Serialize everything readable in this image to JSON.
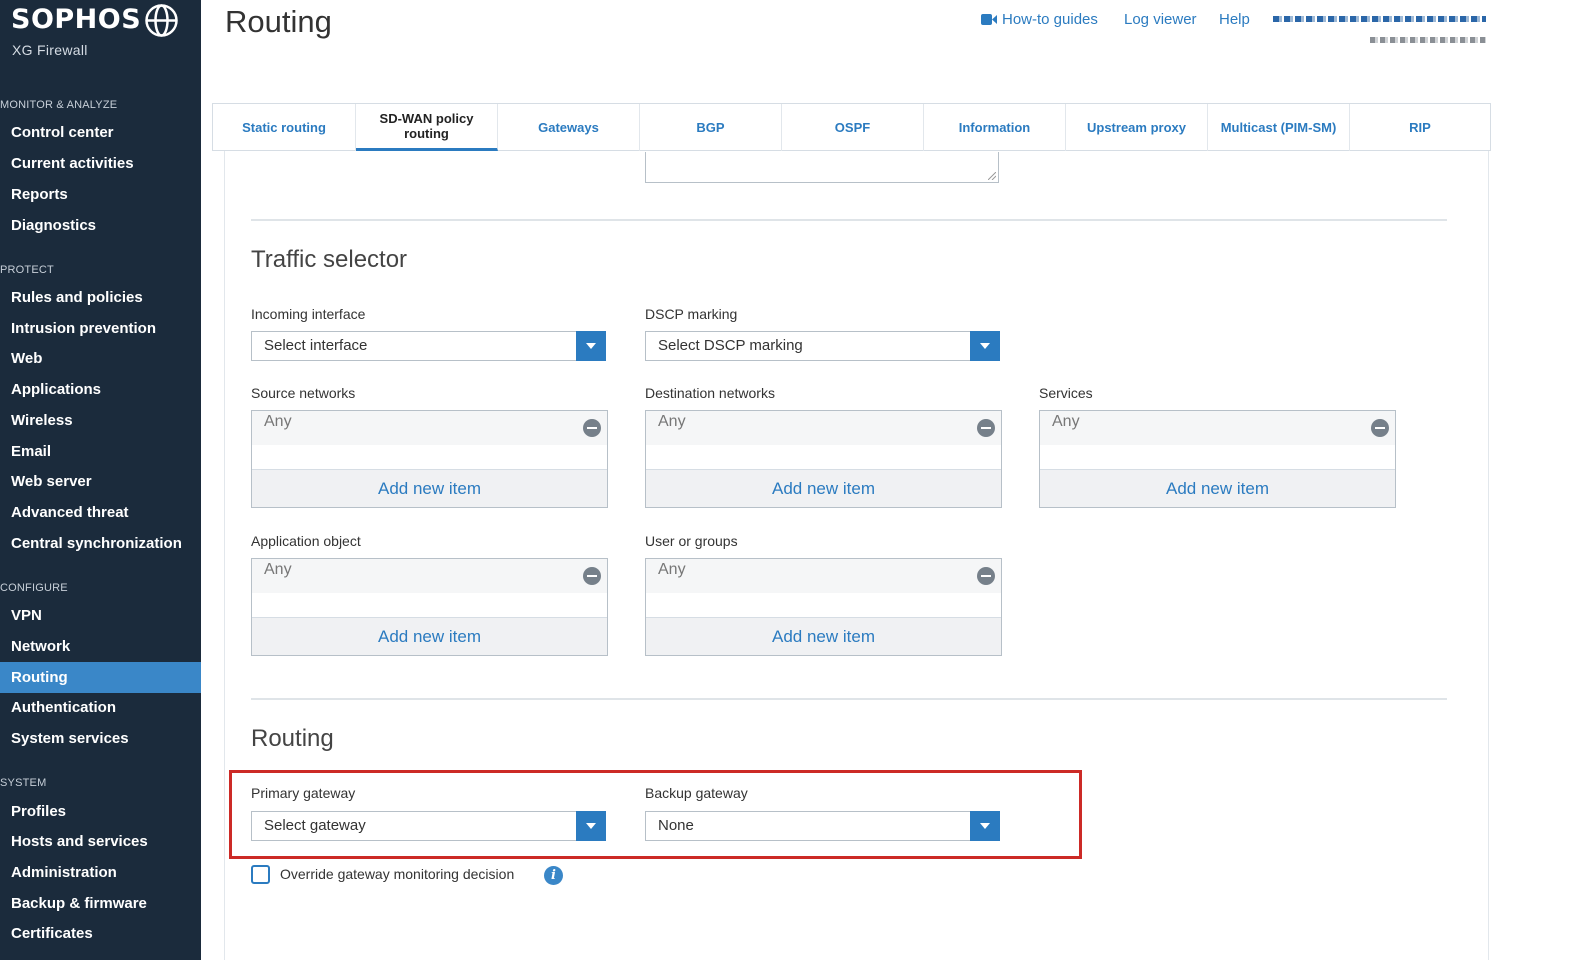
{
  "brand": {
    "name": "SOPHOS",
    "product": "XG Firewall"
  },
  "sidebar": {
    "sections": [
      {
        "title": "MONITOR & ANALYZE",
        "items": [
          "Control center",
          "Current activities",
          "Reports",
          "Diagnostics"
        ]
      },
      {
        "title": "PROTECT",
        "items": [
          "Rules and policies",
          "Intrusion prevention",
          "Web",
          "Applications",
          "Wireless",
          "Email",
          "Web server",
          "Advanced threat",
          "Central synchronization"
        ]
      },
      {
        "title": "CONFIGURE",
        "items": [
          "VPN",
          "Network",
          "Routing",
          "Authentication",
          "System services"
        ]
      },
      {
        "title": "SYSTEM",
        "items": [
          "Profiles",
          "Hosts and services",
          "Administration",
          "Backup & firmware",
          "Certificates"
        ]
      }
    ],
    "active_item": "Routing"
  },
  "header": {
    "title": "Routing",
    "links": {
      "howto": "How-to guides",
      "log": "Log viewer",
      "help": "Help"
    }
  },
  "tabs": [
    "Static routing",
    "SD-WAN policy routing",
    "Gateways",
    "BGP",
    "OSPF",
    "Information",
    "Upstream proxy",
    "Multicast (PIM-SM)",
    "RIP"
  ],
  "active_tab": "SD-WAN policy routing",
  "traffic_selector": {
    "title": "Traffic selector",
    "incoming_interface": {
      "label": "Incoming interface",
      "value": "Select interface"
    },
    "dscp_marking": {
      "label": "DSCP marking",
      "value": "Select DSCP marking"
    },
    "source_networks": {
      "label": "Source networks",
      "item": "Any",
      "add": "Add new item"
    },
    "destination_networks": {
      "label": "Destination networks",
      "item": "Any",
      "add": "Add new item"
    },
    "services": {
      "label": "Services",
      "item": "Any",
      "add": "Add new item"
    },
    "application_object": {
      "label": "Application object",
      "item": "Any",
      "add": "Add new item"
    },
    "user_or_groups": {
      "label": "User or groups",
      "item": "Any",
      "add": "Add new item"
    }
  },
  "routing": {
    "title": "Routing",
    "primary_gateway": {
      "label": "Primary gateway",
      "value": "Select gateway"
    },
    "backup_gateway": {
      "label": "Backup gateway",
      "value": "None"
    },
    "override": {
      "label": "Override gateway monitoring decision",
      "checked": false
    }
  },
  "colors": {
    "sidebar_bg": "#1b2b3c",
    "accent": "#2b7bc0",
    "highlight": "#cc2a26"
  }
}
